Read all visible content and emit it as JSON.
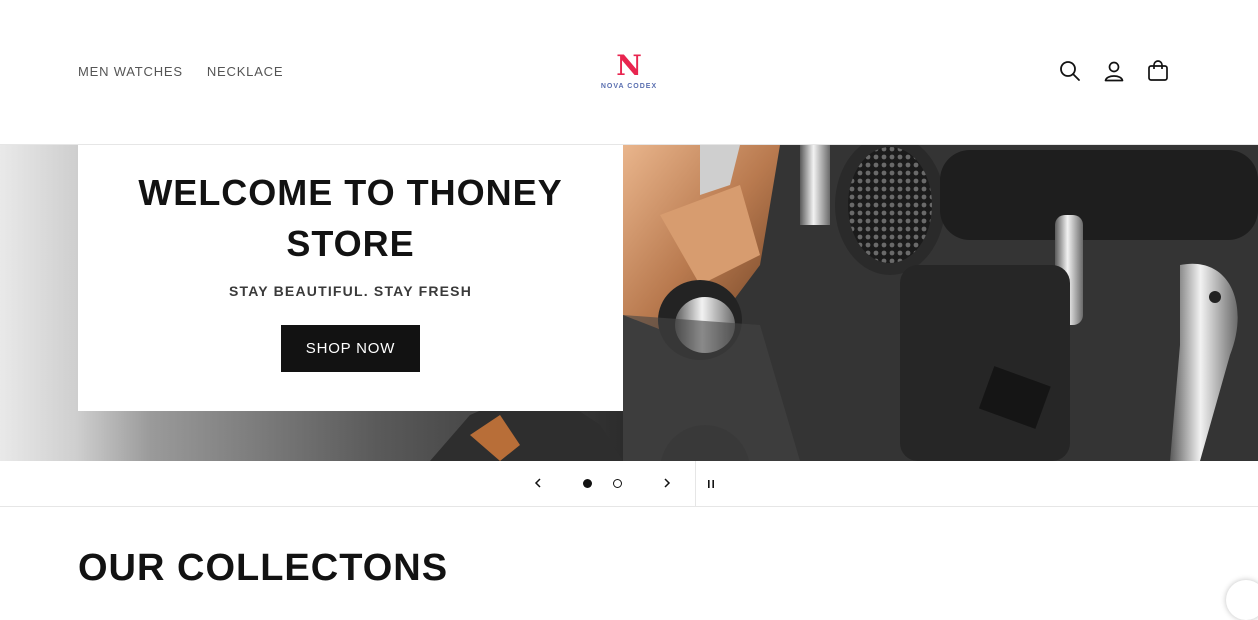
{
  "header": {
    "nav": [
      "MEN WATCHES",
      "NECKLACE"
    ],
    "logo": {
      "mark": "N",
      "sub": "NOVA CODEX"
    },
    "icons": [
      "search-icon",
      "account-icon",
      "cart-icon"
    ]
  },
  "hero": {
    "title": "WELCOME TO THONEY STORE",
    "subtitle": "STAY BEAUTIFUL. STAY FRESH",
    "button": "SHOP NOW"
  },
  "slideshow": {
    "slides": 2,
    "current": 1,
    "controls": [
      "chevron-left-icon",
      "chevron-right-icon",
      "pause-icon"
    ]
  },
  "collections": {
    "title": "OUR COLLECTONS"
  },
  "colors": {
    "brand_red": "#e8254f",
    "brand_blue": "#5a6fb0",
    "button_bg": "#121212"
  }
}
